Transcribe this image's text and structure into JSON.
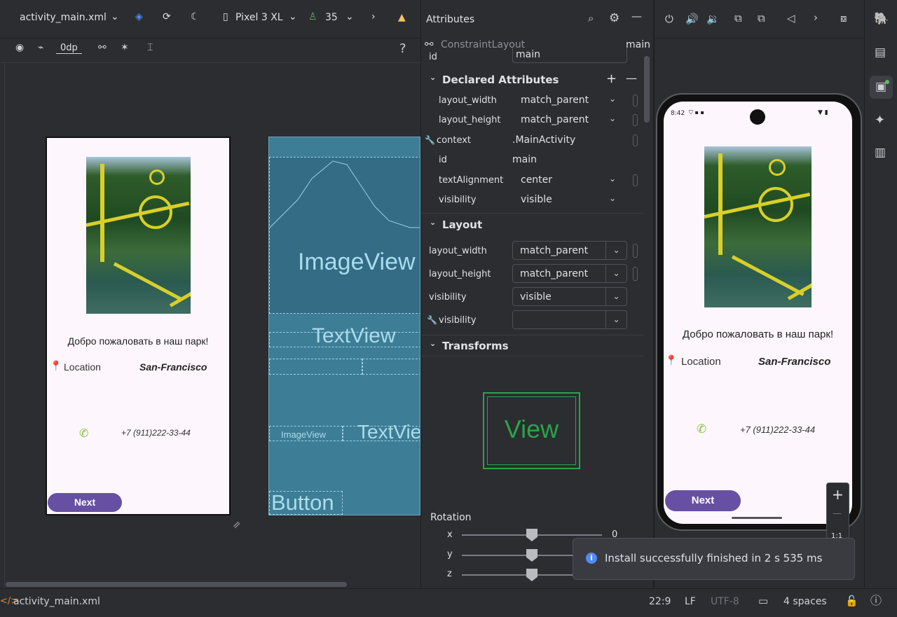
{
  "editor": {
    "file_tab": "activity_main.xml",
    "device": "Pixel 3 XL",
    "api_level": "35",
    "zero_dp": "0dp",
    "help": "?"
  },
  "design_preview": {
    "welcome": "Добро пожаловать в наш парк!",
    "location_label": "Location",
    "location_value": "San-Francisco",
    "phone": "+7 (911)222-33-44",
    "next_button": "Next"
  },
  "blueprint": {
    "image_view": "ImageView",
    "text_view": "TextView",
    "text_view_2": "TextView",
    "image_view_small": "ImageView",
    "button": "Button"
  },
  "attributes": {
    "title": "Attributes",
    "component": "ConstraintLayout",
    "component_id": "main",
    "id_label": "id",
    "id_value": "main",
    "declared_section": "Declared Attributes",
    "declared": [
      {
        "key": "layout_width",
        "value": "match_parent"
      },
      {
        "key": "layout_height",
        "value": "match_parent"
      },
      {
        "key": "context",
        "value": ".MainActivity"
      },
      {
        "key": "id",
        "value": "main"
      },
      {
        "key": "textAlignment",
        "value": "center"
      },
      {
        "key": "visibility",
        "value": "visible"
      }
    ],
    "layout_section": "Layout",
    "layout": [
      {
        "key": "layout_width",
        "value": "match_parent"
      },
      {
        "key": "layout_height",
        "value": "match_parent"
      },
      {
        "key": "visibility",
        "value": "visible"
      },
      {
        "key": "visibility",
        "value": ""
      }
    ],
    "transforms_section": "Transforms",
    "view_preview": "View",
    "rotation_label": "Rotation",
    "rotation": [
      {
        "axis": "x",
        "value": "0",
        "fraction": 0.5
      },
      {
        "axis": "y",
        "value": "",
        "fraction": 0.5
      },
      {
        "axis": "z",
        "value": "",
        "fraction": 0.5
      }
    ]
  },
  "running_device": {
    "status_time": "8:42",
    "welcome": "Добро пожаловать в наш парк!",
    "location_label": "Location",
    "location_value": "San-Francisco",
    "phone": "+7 (911)222-33-44",
    "next_button": "Next",
    "zoom_plus": "+",
    "zoom_minus": "—",
    "zoom_reset": "1:1"
  },
  "toast": {
    "message": "Install successfully finished in 2 s 535 ms"
  },
  "status_bar": {
    "file": "activity_main.xml",
    "position": "22:9",
    "line_sep": "LF",
    "encoding": "UTF-8",
    "indent": "4 spaces"
  },
  "colors": {
    "accent": "#6750a4",
    "blueprint": "#3e7d96",
    "view_green": "#2aa44a",
    "info_blue": "#548af7"
  }
}
